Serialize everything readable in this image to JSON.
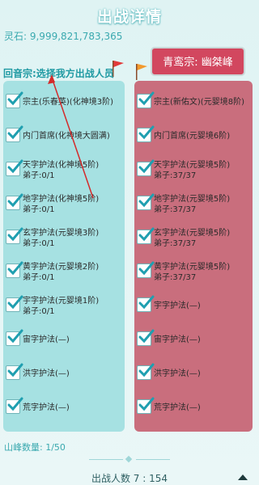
{
  "header": {
    "title": "出战详情"
  },
  "resources": {
    "spirit_stone": "灵石: 9,999,821,783,365"
  },
  "enemy": {
    "name": "青鸾宗: 幽桀峰"
  },
  "left_panel": {
    "label": "回音宗:选择我方出战人员",
    "rows": [
      {
        "checked": true,
        "title": "宗主(乐春英)(化神境3阶)",
        "sub": ""
      },
      {
        "checked": true,
        "title": "内门首席(化神境大圆满)",
        "sub": ""
      },
      {
        "checked": true,
        "title": "天字护法(化神境5阶)",
        "sub": "弟子:0/1"
      },
      {
        "checked": true,
        "title": "地字护法(化神境5阶)",
        "sub": "弟子:0/1"
      },
      {
        "checked": true,
        "title": "玄字护法(元婴境3阶)",
        "sub": "弟子:0/1"
      },
      {
        "checked": true,
        "title": "黄字护法(元婴境2阶)",
        "sub": "弟子:0/1"
      },
      {
        "checked": true,
        "title": "宇字护法(元婴境1阶)",
        "sub": "弟子:0/1"
      },
      {
        "checked": true,
        "title": "宙字护法(—)",
        "sub": ""
      },
      {
        "checked": true,
        "title": "洪字护法(—)",
        "sub": ""
      },
      {
        "checked": true,
        "title": "荒字护法(—)",
        "sub": ""
      }
    ]
  },
  "right_panel": {
    "rows": [
      {
        "checked": true,
        "title": "宗主(新佑文)(元婴境8阶)",
        "sub": ""
      },
      {
        "checked": true,
        "title": "内门首席(元婴境6阶)",
        "sub": ""
      },
      {
        "checked": true,
        "title": "天字护法(元婴境5阶)",
        "sub": "弟子:37/37"
      },
      {
        "checked": true,
        "title": "地字护法(元婴境5阶)",
        "sub": "弟子:37/37"
      },
      {
        "checked": true,
        "title": "玄字护法(元婴境5阶)",
        "sub": "弟子:37/37"
      },
      {
        "checked": true,
        "title": "黄字护法(元婴境5阶)",
        "sub": "弟子:37/37"
      },
      {
        "checked": true,
        "title": "宇字护法(—)",
        "sub": ""
      },
      {
        "checked": true,
        "title": "宙字护法(—)",
        "sub": ""
      },
      {
        "checked": true,
        "title": "洪字护法(—)",
        "sub": ""
      },
      {
        "checked": true,
        "title": "荒字护法(—)",
        "sub": ""
      }
    ]
  },
  "footer": {
    "mountain_count": "山峰数量: 1/50",
    "attendee_count": "出战人数 7 : 154"
  },
  "icons": {
    "check": "checkmark-icon",
    "red_flag": "red-flag-icon",
    "orange_flag": "orange-flag-icon",
    "arrow": "chevron-up-icon"
  },
  "colors": {
    "header": "#ffffff",
    "left_panel": "#a6e1e2",
    "right_panel": "#c96e7d",
    "enemy_banner": "#d2475f",
    "check": "#1f9fb0",
    "annotation": "#d42a2a"
  }
}
